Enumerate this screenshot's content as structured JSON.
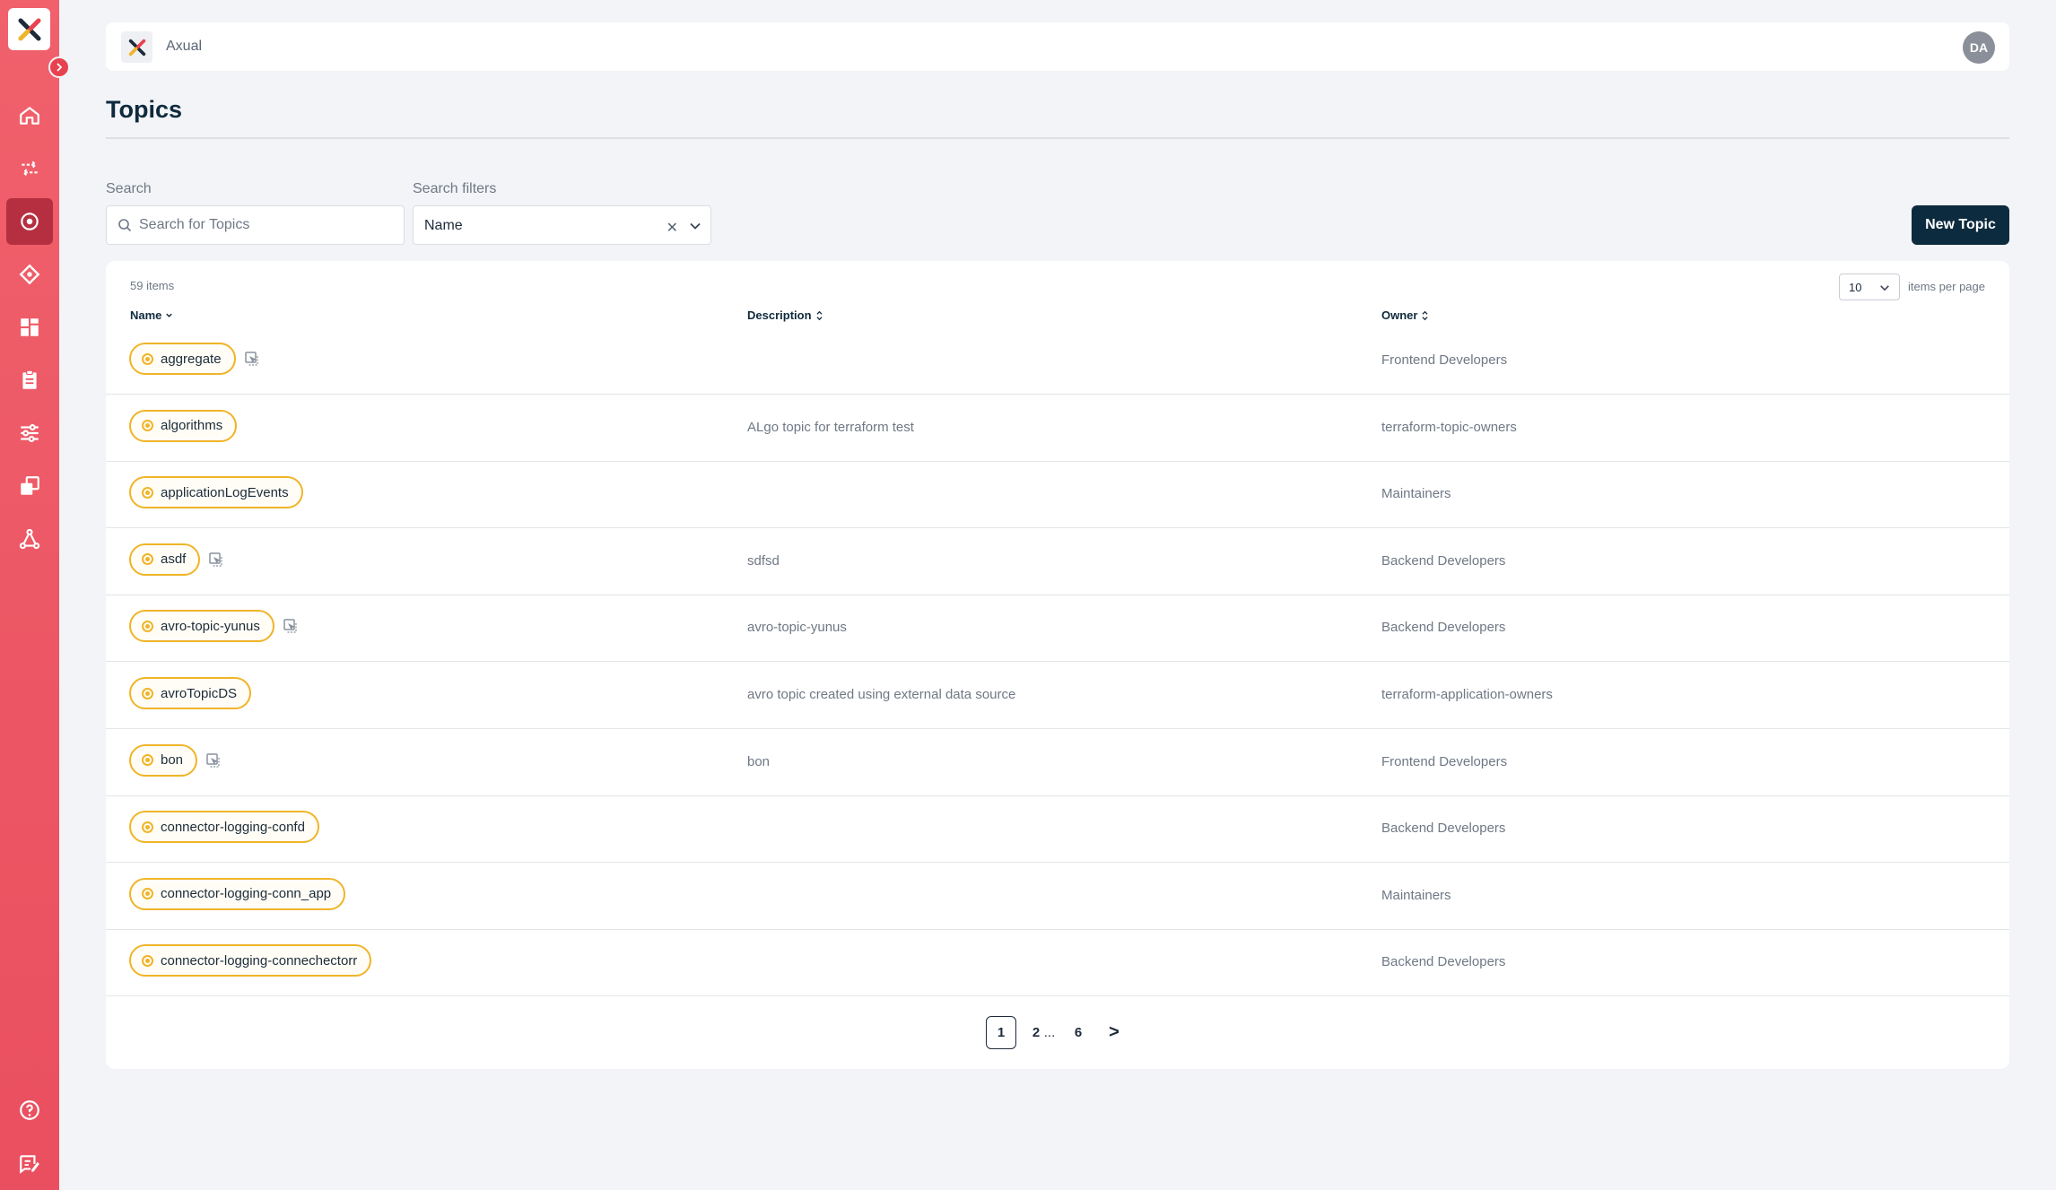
{
  "app": {
    "title": "Axual",
    "user_initials": "DA"
  },
  "sidebar": {
    "items": [
      {
        "name": "home-icon"
      },
      {
        "name": "streams-icon"
      },
      {
        "name": "topics-icon",
        "active": true
      },
      {
        "name": "applications-icon"
      },
      {
        "name": "dashboard-icon"
      },
      {
        "name": "clipboard-icon"
      },
      {
        "name": "settings-sliders-icon"
      },
      {
        "name": "environments-icon"
      },
      {
        "name": "connections-icon"
      }
    ],
    "bottom": [
      {
        "name": "help-icon"
      },
      {
        "name": "feedback-icon"
      }
    ]
  },
  "page": {
    "title": "Topics"
  },
  "search": {
    "label": "Search",
    "placeholder": "Search for Topics"
  },
  "filters": {
    "label": "Search filters",
    "selected": "Name"
  },
  "actions": {
    "new_topic": "New Topic"
  },
  "table": {
    "items_count": "59 items",
    "per_page": "10",
    "per_page_label": "items per page",
    "columns": {
      "name": "Name",
      "description": "Description",
      "owner": "Owner"
    },
    "rows": [
      {
        "name": "aggregate",
        "description": "",
        "owner": "Frontend Developers",
        "schema": true
      },
      {
        "name": "algorithms",
        "description": "ALgo topic for terraform test",
        "owner": "terraform-topic-owners",
        "schema": false
      },
      {
        "name": "applicationLogEvents",
        "description": "",
        "owner": "Maintainers",
        "schema": false
      },
      {
        "name": "asdf",
        "description": "sdfsd",
        "owner": "Backend Developers",
        "schema": true
      },
      {
        "name": "avro-topic-yunus",
        "description": "avro-topic-yunus",
        "owner": "Backend Developers",
        "schema": true
      },
      {
        "name": "avroTopicDS",
        "description": "avro topic created using external data source",
        "owner": "terraform-application-owners",
        "schema": false
      },
      {
        "name": "bon",
        "description": "bon",
        "owner": "Frontend Developers",
        "schema": true
      },
      {
        "name": "connector-logging-confd",
        "description": "",
        "owner": "Backend Developers",
        "schema": false
      },
      {
        "name": "connector-logging-conn_app",
        "description": "",
        "owner": "Maintainers",
        "schema": false
      },
      {
        "name": "connector-logging-connechectorr",
        "description": "",
        "owner": "Backend Developers",
        "schema": false
      }
    ]
  },
  "pagination": {
    "current": "1",
    "pages": [
      "1",
      "2",
      "6"
    ],
    "ellipsis": "...",
    "next": ">"
  },
  "colors": {
    "accent": "#0d2b3e",
    "sidebar": "#ea4f5f",
    "topic_pill": "#f0b429"
  }
}
